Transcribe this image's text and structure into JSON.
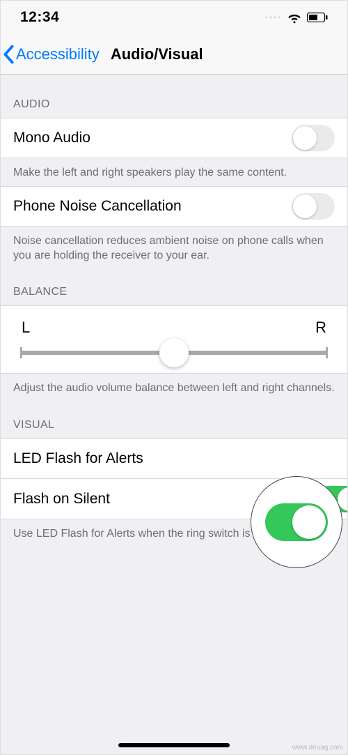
{
  "statusbar": {
    "time": "12:34"
  },
  "nav": {
    "back_label": "Accessibility",
    "title": "Audio/Visual"
  },
  "audio": {
    "header": "Audio",
    "mono_label": "Mono Audio",
    "mono_footer": "Make the left and right speakers play the same content.",
    "noise_label": "Phone Noise Cancellation",
    "noise_footer": "Noise cancellation reduces ambient noise on phone calls when you are holding the receiver to your ear.",
    "mono_on": false,
    "noise_on": false
  },
  "balance": {
    "header": "Balance",
    "left": "L",
    "right": "R",
    "value": 0.5,
    "footer": "Adjust the audio volume balance between left and right channels."
  },
  "visual": {
    "header": "Visual",
    "led_label": "LED Flash for Alerts",
    "silent_label": "Flash on Silent",
    "led_on": true,
    "silent_on": true,
    "footer": "Use LED Flash for Alerts when the ring switch is set to silent."
  },
  "watermark": "www.deuaq.com"
}
